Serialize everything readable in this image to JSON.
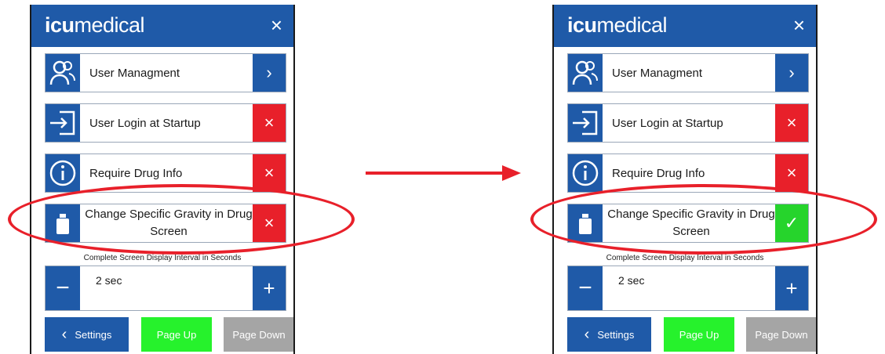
{
  "colors": {
    "brand_blue": "#1f5aa8",
    "toggle_off": "#e8202a",
    "toggle_on": "#26d42c",
    "page_up": "#26f22c",
    "page_down": "#a5a5a5",
    "annotation_red": "#e8202a"
  },
  "header": {
    "logo_bold": "icu",
    "logo_thin": "medical",
    "close_label": "×"
  },
  "rows": {
    "user_management": {
      "label": "User Managment",
      "action": "›"
    },
    "user_login": {
      "label": "User Login at Startup",
      "state": "×"
    },
    "drug_info": {
      "label": "Require Drug Info",
      "state": "×"
    },
    "gravity": {
      "label": "Change Specific Gravity in Drug Screen"
    }
  },
  "gravity_state": {
    "before": "×",
    "after": "✓"
  },
  "display_interval": {
    "caption": "Complete Screen Display Interval in Seconds",
    "value": "2 sec",
    "minus": "−",
    "plus": "+"
  },
  "nav": {
    "settings": "Settings",
    "page_up": "Page Up",
    "page_down": "Page Down"
  }
}
